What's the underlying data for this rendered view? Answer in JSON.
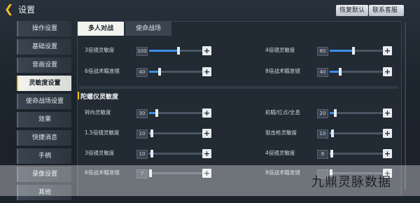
{
  "header": {
    "title": "设置",
    "reset_label": "恢复默认",
    "contact_label": "联系客服"
  },
  "sidebar": {
    "items": [
      {
        "label": "操作设置",
        "active": false
      },
      {
        "label": "基础设置",
        "active": false
      },
      {
        "label": "音画设置",
        "active": false
      },
      {
        "label": "灵敏度设置",
        "active": true
      },
      {
        "label": "使命战场设置",
        "active": false
      },
      {
        "label": "效果",
        "active": false
      },
      {
        "label": "快捷消息",
        "active": false
      },
      {
        "label": "手柄",
        "active": false
      },
      {
        "label": "录像设置",
        "active": false
      },
      {
        "label": "其他",
        "active": false
      }
    ]
  },
  "tabs": [
    {
      "label": "多人对战",
      "active": true
    },
    {
      "label": "使命战场",
      "active": false
    }
  ],
  "top_rows": [
    {
      "label": "3倍镜灵敏度",
      "value": "100",
      "level": 0.55
    },
    {
      "label": "4倍镜灵敏度",
      "value": "80",
      "level": 0.45
    },
    {
      "label": "6倍战术瞄准镜",
      "value": "40",
      "level": 0.2
    },
    {
      "label": "8倍战术瞄准镜",
      "value": "40",
      "level": 0.2
    }
  ],
  "gyro": {
    "title": "陀螺仪灵敏度",
    "rows": [
      {
        "label": "转向灵敏度",
        "value": "30",
        "level": 0.15
      },
      {
        "label": "机瞄/红点/全息",
        "value": "20",
        "level": 0.1
      },
      {
        "label": "1.5倍镜灵敏度",
        "value": "10",
        "level": 0.05
      },
      {
        "label": "狙击枪灵敏度",
        "value": "10",
        "level": 0.05
      },
      {
        "label": "3倍镜灵敏度",
        "value": "10",
        "level": 0.05
      },
      {
        "label": "4倍镜灵敏度",
        "value": "8",
        "level": 0.04
      },
      {
        "label": "6倍战术瞄准镜",
        "value": "7",
        "level": 0.03
      },
      {
        "label": "8倍战术瞄准镜",
        "value": "",
        "level": 0.03
      }
    ]
  },
  "watermark": "九鼎灵脉数据",
  "colors": {
    "accent": "#f1c21b",
    "slider_fill": "#3b8ee8"
  }
}
